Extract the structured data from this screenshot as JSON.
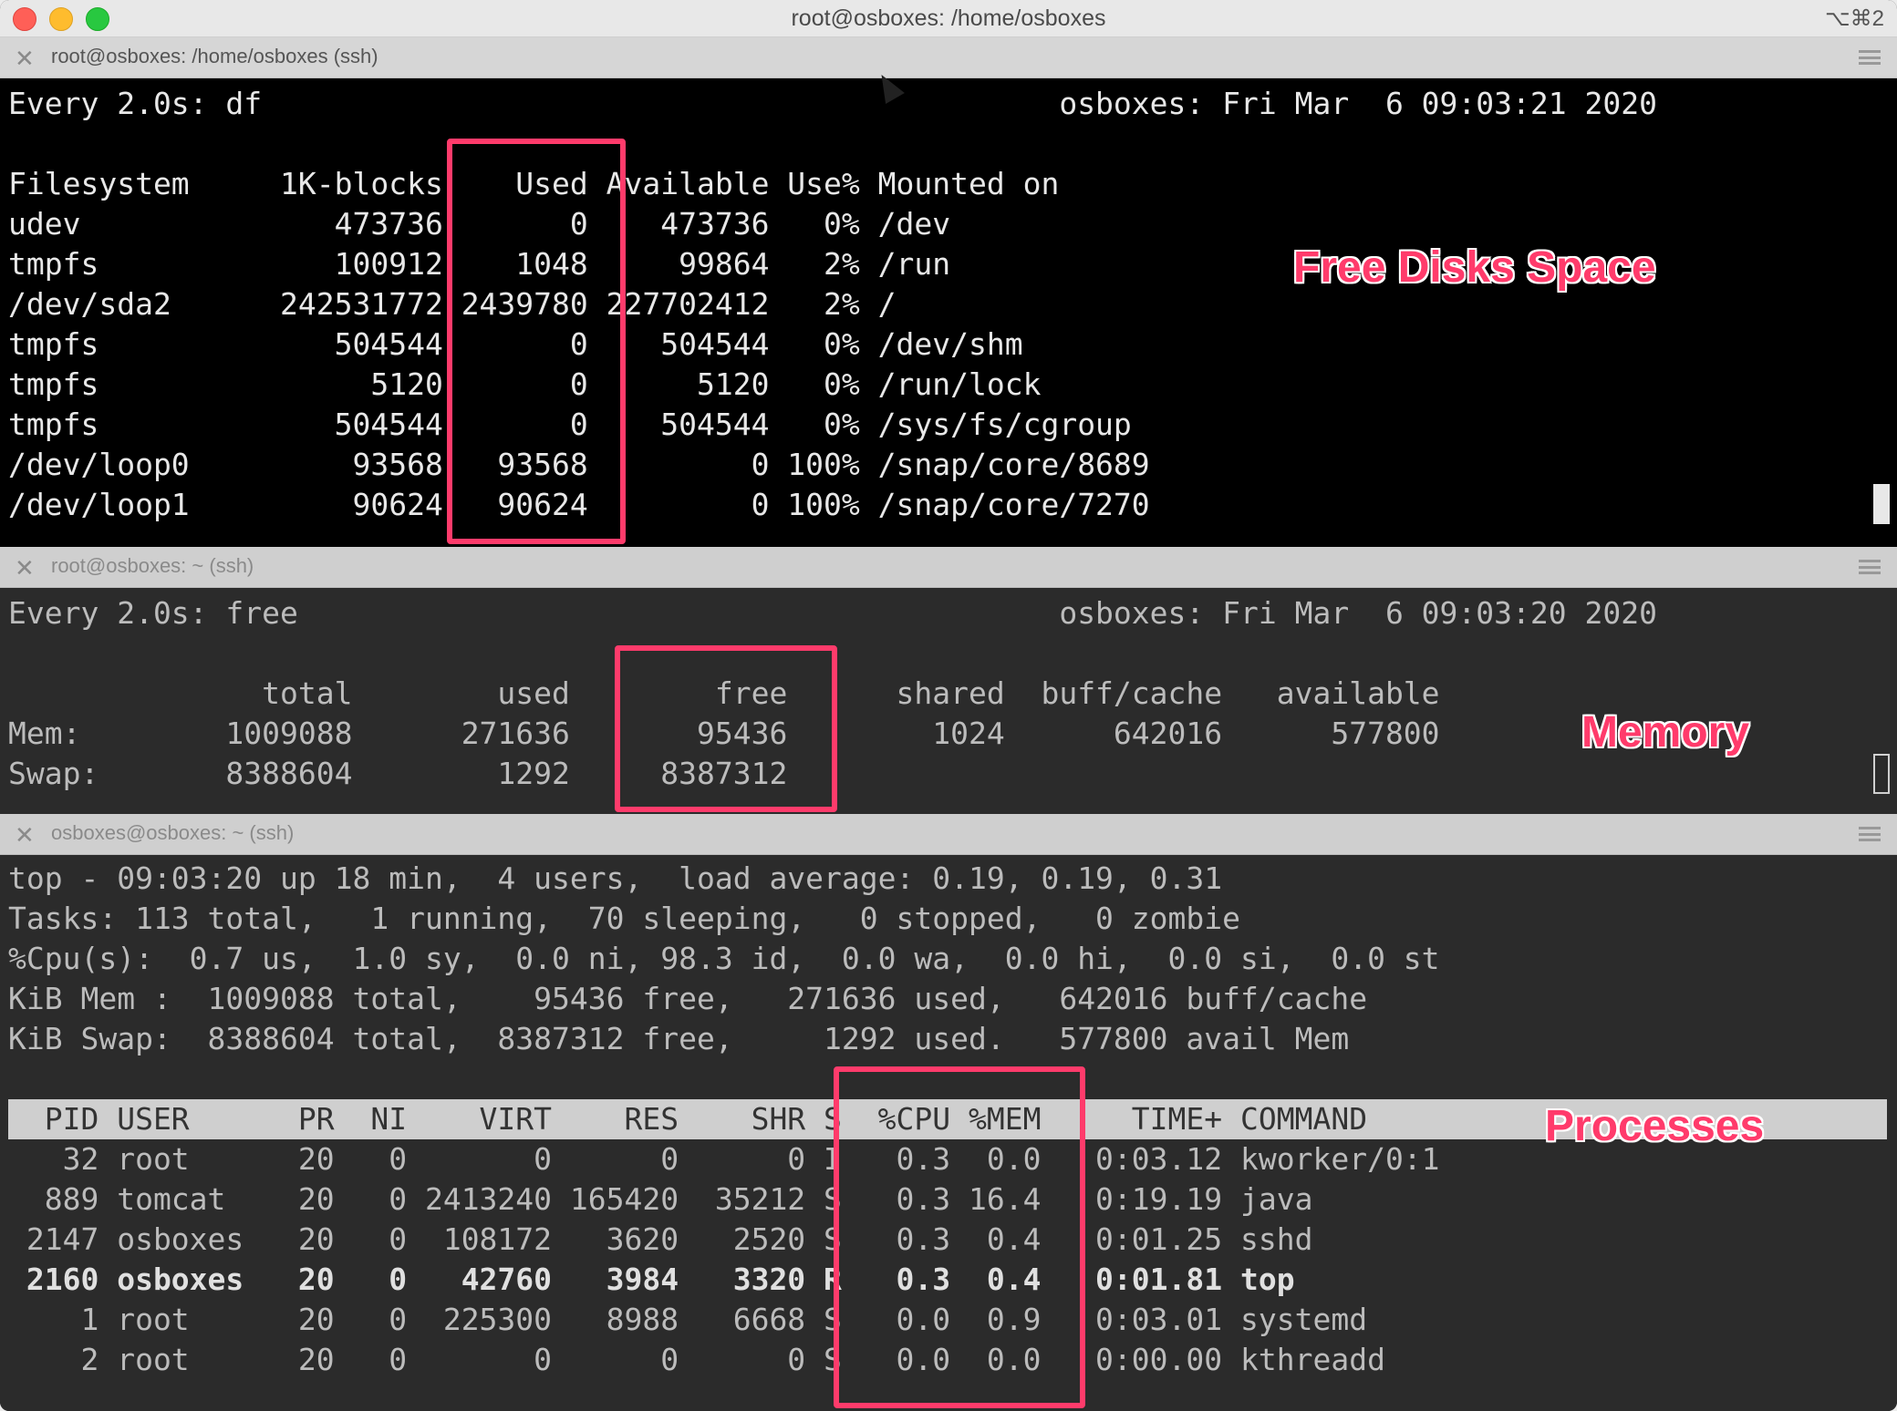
{
  "window": {
    "title": "root@osboxes: /home/osboxes",
    "shortcut": "⌥⌘2"
  },
  "pane1": {
    "tab_title": "root@osboxes: /home/osboxes (ssh)",
    "lines": [
      "Every 2.0s: df                                            osboxes: Fri Mar  6 09:03:21 2020",
      "",
      "Filesystem     1K-blocks    Used Available Use% Mounted on",
      "udev              473736       0    473736   0% /dev",
      "tmpfs             100912    1048     99864   2% /run",
      "/dev/sda2      242531772 2439780 227702412   2% /",
      "tmpfs             504544       0    504544   0% /dev/shm",
      "tmpfs               5120       0      5120   0% /run/lock",
      "tmpfs             504544       0    504544   0% /sys/fs/cgroup",
      "/dev/loop0         93568   93568         0 100% /snap/core/8689",
      "/dev/loop1         90624   90624         0 100% /snap/core/7270"
    ]
  },
  "pane2": {
    "tab_title": "root@osboxes: ~ (ssh)",
    "lines": [
      "Every 2.0s: free                                          osboxes: Fri Mar  6 09:03:20 2020",
      "",
      "              total        used        free      shared  buff/cache   available",
      "Mem:        1009088      271636       95436        1024      642016      577800",
      "Swap:       8388604        1292     8387312"
    ]
  },
  "pane3": {
    "tab_title": "osboxes@osboxes: ~ (ssh)",
    "summary": [
      "top - 09:03:20 up 18 min,  4 users,  load average: 0.19, 0.19, 0.31",
      "Tasks: 113 total,   1 running,  70 sleeping,   0 stopped,   0 zombie",
      "%Cpu(s):  0.7 us,  1.0 sy,  0.0 ni, 98.3 id,  0.0 wa,  0.0 hi,  0.0 si,  0.0 st",
      "KiB Mem :  1009088 total,    95436 free,   271636 used,   642016 buff/cache",
      "KiB Swap:  8388604 total,  8387312 free,     1292 used.   577800 avail Mem"
    ],
    "header": "  PID USER      PR  NI    VIRT    RES    SHR S  %CPU %MEM     TIME+ COMMAND",
    "rows": [
      "   32 root      20   0       0      0      0 I   0.3  0.0   0:03.12 kworker/0:1",
      "  889 tomcat    20   0 2413240 165420  35212 S   0.3 16.4   0:19.19 java",
      " 2147 osboxes   20   0  108172   3620   2520 S   0.3  0.4   0:01.25 sshd",
      " 2160 osboxes   20   0   42760   3984   3320 R   0.3  0.4   0:01.81 top",
      "    1 root      20   0  225300   8988   6668 S   0.0  0.9   0:03.01 systemd",
      "    2 root      20   0       0      0      0 S   0.0  0.0   0:00.00 kthreadd"
    ]
  },
  "annotations": {
    "disk": "Free Disks Space",
    "memory": "Memory",
    "processes": "Processes"
  },
  "colors": {
    "highlight": "#ff3b6b"
  }
}
